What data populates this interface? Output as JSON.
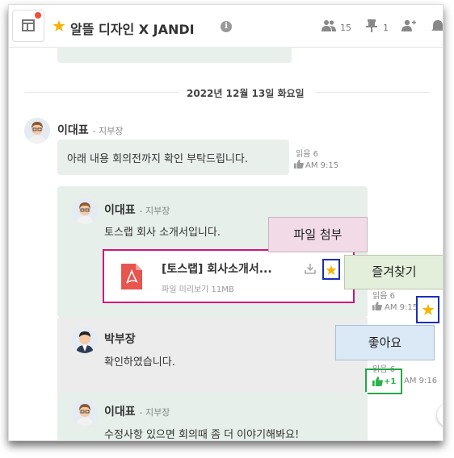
{
  "header": {
    "title": "알뜰 디자인 X JANDI",
    "members_count": "15",
    "pins_count": "1"
  },
  "date_divider": "2022년 12월 13일 화요일",
  "message1": {
    "author": "이대표",
    "role": "- 지부장",
    "text": "아래 내용 회의전까지 확인 부탁드립니다.",
    "read": "읽음 6",
    "time": "AM 9:15"
  },
  "message2": {
    "author": "이대표",
    "role": "- 지부장",
    "text": "토스랩 회사 소개서입니다.",
    "file": {
      "name": "[토스랩] 회사소개서...",
      "meta": "파일 미리보기 11MB"
    },
    "read": "읽음 6",
    "time": "AM 9:15"
  },
  "message3": {
    "author": "박부장",
    "text": "확인하였습니다.",
    "read": "읽음 6",
    "likes": "+1",
    "time": "AM 9:16"
  },
  "message4": {
    "author": "이대표",
    "role": "- 지부장",
    "text": "수정사항 있으면 회의때 좀 더 이야기해봐요!"
  },
  "callouts": {
    "attach": "파일 첨부",
    "favorite": "즐겨찾기",
    "like": "좋아요"
  },
  "colors": {
    "accent_star": "#f5b400",
    "like_green": "#2bb24c",
    "annotation_magenta": "#d0147a",
    "annotation_blue": "#1a2fb8",
    "annotation_green": "#22a845"
  }
}
